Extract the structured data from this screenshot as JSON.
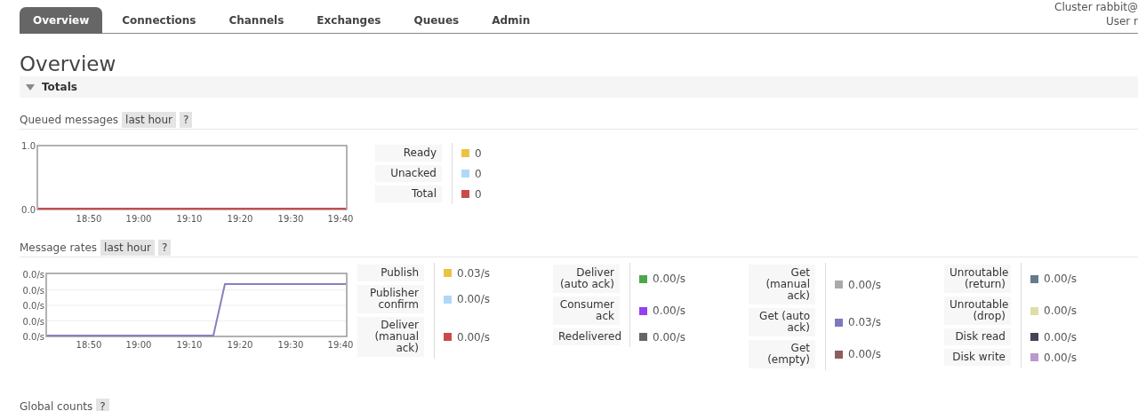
{
  "header": {
    "tabs": [
      {
        "label": "Overview",
        "selected": true
      },
      {
        "label": "Connections",
        "selected": false
      },
      {
        "label": "Channels",
        "selected": false
      },
      {
        "label": "Exchanges",
        "selected": false
      },
      {
        "label": "Queues",
        "selected": false
      },
      {
        "label": "Admin",
        "selected": false
      }
    ],
    "cluster": "Cluster rabbit@",
    "user": "User r"
  },
  "page_title": "Overview",
  "totals": {
    "label": "Totals",
    "expanded": true,
    "queued_messages": {
      "title": "Queued messages",
      "range": "last hour",
      "help": "?",
      "y_labels": [
        "1.0",
        "0.0"
      ],
      "x_labels": [
        "18:50",
        "19:00",
        "19:10",
        "19:20",
        "19:30",
        "19:40"
      ],
      "legend": [
        {
          "label": "Ready",
          "color": "#edc240",
          "value": "0"
        },
        {
          "label": "Unacked",
          "color": "#afd8f8",
          "value": "0"
        },
        {
          "label": "Total",
          "color": "#cb4b4b",
          "value": "0"
        }
      ]
    },
    "message_rates": {
      "title": "Message rates",
      "range": "last hour",
      "help": "?",
      "y_labels": [
        "0.0/s",
        "0.0/s",
        "0.0/s",
        "0.0/s",
        "0.0/s"
      ],
      "x_labels": [
        "18:50",
        "19:00",
        "19:10",
        "19:20",
        "19:30",
        "19:40"
      ],
      "groups": [
        [
          {
            "label": "Publish",
            "color": "#edc240",
            "value": "0.03/s"
          },
          {
            "label": "Publisher confirm",
            "color": "#afd8f8",
            "value": "0.00/s"
          },
          {
            "label": "Deliver (manual ack)",
            "color": "#cb4b4b",
            "value": "0.00/s"
          }
        ],
        [
          {
            "label": "Deliver (auto ack)",
            "color": "#4da74d",
            "value": "0.00/s"
          },
          {
            "label": "Consumer ack",
            "color": "#9440ed",
            "value": "0.00/s"
          },
          {
            "label": "Redelivered",
            "color": "#666666",
            "value": "0.00/s"
          }
        ],
        [
          {
            "label": "Get (manual ack)",
            "color": "#aaaaaa",
            "value": "0.00/s"
          },
          {
            "label": "Get (auto ack)",
            "color": "#7c79c0",
            "value": "0.03/s"
          },
          {
            "label": "Get (empty)",
            "color": "#8c5e5e",
            "value": "0.00/s"
          }
        ],
        [
          {
            "label": "Unroutable (return)",
            "color": "#647c8a",
            "value": "0.00/s"
          },
          {
            "label": "Unroutable (drop)",
            "color": "#dedeaa",
            "value": "0.00/s"
          },
          {
            "label": "Disk read",
            "color": "#444455",
            "value": "0.00/s"
          },
          {
            "label": "Disk write",
            "color": "#bb99cc",
            "value": "0.00/s"
          }
        ]
      ]
    },
    "global_counts": {
      "title": "Global counts",
      "help": "?"
    }
  }
}
